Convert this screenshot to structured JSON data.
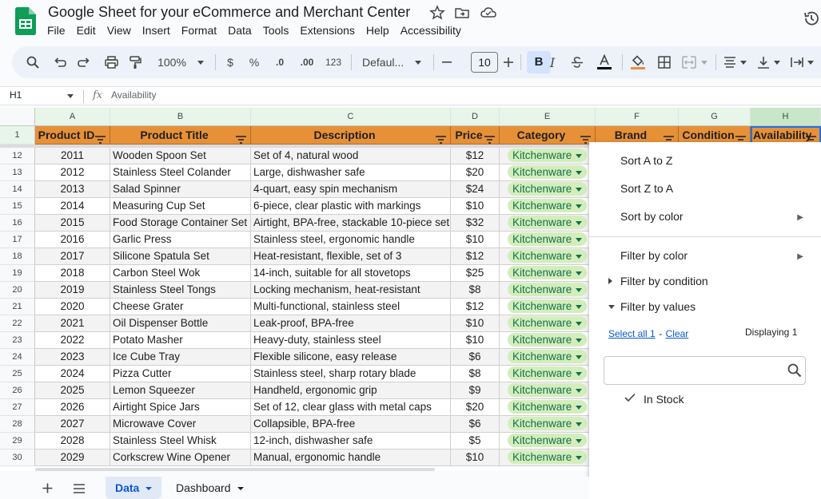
{
  "app": {
    "doc_title": "Google Sheet for your eCommerce and Merchant Center",
    "menu": [
      "File",
      "Edit",
      "View",
      "Insert",
      "Format",
      "Data",
      "Tools",
      "Extensions",
      "Help",
      "Accessibility"
    ]
  },
  "toolbar": {
    "zoom": "100%",
    "currency": "$",
    "percent": "%",
    "decrease_decimal": ".0",
    "increase_decimal": ".00",
    "number_format": "123",
    "font": "Defaul...",
    "font_size": "10",
    "bold": "B",
    "italic": "I"
  },
  "formula_bar": {
    "cell_ref": "H1",
    "fx": "fx",
    "formula": "Availability"
  },
  "grid": {
    "columns": [
      "A",
      "B",
      "C",
      "D",
      "E",
      "F",
      "G",
      "H"
    ],
    "header_row_number": "1",
    "headers": [
      "Product ID",
      "Product Title",
      "Description",
      "Price",
      "Category",
      "Brand",
      "Condition",
      "Availability"
    ],
    "rows": [
      {
        "row": "12",
        "id": "2011",
        "title": "Wooden Spoon Set",
        "desc": "Set of 4, natural wood",
        "price": "$12",
        "category": "Kitchenware"
      },
      {
        "row": "13",
        "id": "2012",
        "title": "Stainless Steel Colander",
        "desc": "Large, dishwasher safe",
        "price": "$20",
        "category": "Kitchenware"
      },
      {
        "row": "14",
        "id": "2013",
        "title": "Salad Spinner",
        "desc": "4-quart, easy spin mechanism",
        "price": "$24",
        "category": "Kitchenware"
      },
      {
        "row": "15",
        "id": "2014",
        "title": "Measuring Cup Set",
        "desc": "6-piece, clear plastic with markings",
        "price": "$10",
        "category": "Kitchenware"
      },
      {
        "row": "16",
        "id": "2015",
        "title": "Food Storage Container Set",
        "desc": "Airtight, BPA-free, stackable 10-piece set",
        "price": "$32",
        "category": "Kitchenware"
      },
      {
        "row": "17",
        "id": "2016",
        "title": "Garlic Press",
        "desc": "Stainless steel, ergonomic handle",
        "price": "$10",
        "category": "Kitchenware"
      },
      {
        "row": "18",
        "id": "2017",
        "title": "Silicone Spatula Set",
        "desc": "Heat-resistant, flexible, set of 3",
        "price": "$12",
        "category": "Kitchenware"
      },
      {
        "row": "19",
        "id": "2018",
        "title": "Carbon Steel Wok",
        "desc": "14-inch, suitable for all stovetops",
        "price": "$25",
        "category": "Kitchenware"
      },
      {
        "row": "20",
        "id": "2019",
        "title": "Stainless Steel Tongs",
        "desc": "Locking mechanism, heat-resistant",
        "price": "$8",
        "category": "Kitchenware"
      },
      {
        "row": "21",
        "id": "2020",
        "title": "Cheese Grater",
        "desc": "Multi-functional, stainless steel",
        "price": "$12",
        "category": "Kitchenware"
      },
      {
        "row": "22",
        "id": "2021",
        "title": "Oil Dispenser Bottle",
        "desc": "Leak-proof, BPA-free",
        "price": "$10",
        "category": "Kitchenware"
      },
      {
        "row": "23",
        "id": "2022",
        "title": "Potato Masher",
        "desc": "Heavy-duty, stainless steel",
        "price": "$10",
        "category": "Kitchenware"
      },
      {
        "row": "24",
        "id": "2023",
        "title": "Ice Cube Tray",
        "desc": "Flexible silicone, easy release",
        "price": "$6",
        "category": "Kitchenware"
      },
      {
        "row": "25",
        "id": "2024",
        "title": "Pizza Cutter",
        "desc": "Stainless steel, sharp rotary blade",
        "price": "$8",
        "category": "Kitchenware"
      },
      {
        "row": "26",
        "id": "2025",
        "title": "Lemon Squeezer",
        "desc": "Handheld, ergonomic grip",
        "price": "$9",
        "category": "Kitchenware"
      },
      {
        "row": "27",
        "id": "2026",
        "title": "Airtight Spice Jars",
        "desc": "Set of 12, clear glass with metal caps",
        "price": "$20",
        "category": "Kitchenware"
      },
      {
        "row": "28",
        "id": "2027",
        "title": "Microwave Cover",
        "desc": "Collapsible, BPA-free",
        "price": "$6",
        "category": "Kitchenware"
      },
      {
        "row": "29",
        "id": "2028",
        "title": "Stainless Steel Whisk",
        "desc": "12-inch, dishwasher safe",
        "price": "$5",
        "category": "Kitchenware"
      },
      {
        "row": "30",
        "id": "2029",
        "title": "Corkscrew Wine Opener",
        "desc": "Manual, ergonomic handle",
        "price": "$10",
        "category": "Kitchenware"
      }
    ]
  },
  "filter_menu": {
    "sort_az": "Sort A to Z",
    "sort_za": "Sort Z to A",
    "sort_color": "Sort by color",
    "filter_color": "Filter by color",
    "filter_condition": "Filter by condition",
    "filter_values": "Filter by values",
    "select_all": "Select all 1",
    "link_sep": "-",
    "clear": "Clear",
    "displaying": "Displaying 1",
    "search_placeholder": "",
    "values": [
      "In Stock"
    ]
  },
  "sheets": {
    "tabs": [
      "Data",
      "Dashboard"
    ],
    "active": "Data"
  },
  "colors": {
    "header_fill": "#e69138",
    "chip_bg": "#d4edbc",
    "chip_text": "#11734b",
    "link": "#0b57d0"
  }
}
